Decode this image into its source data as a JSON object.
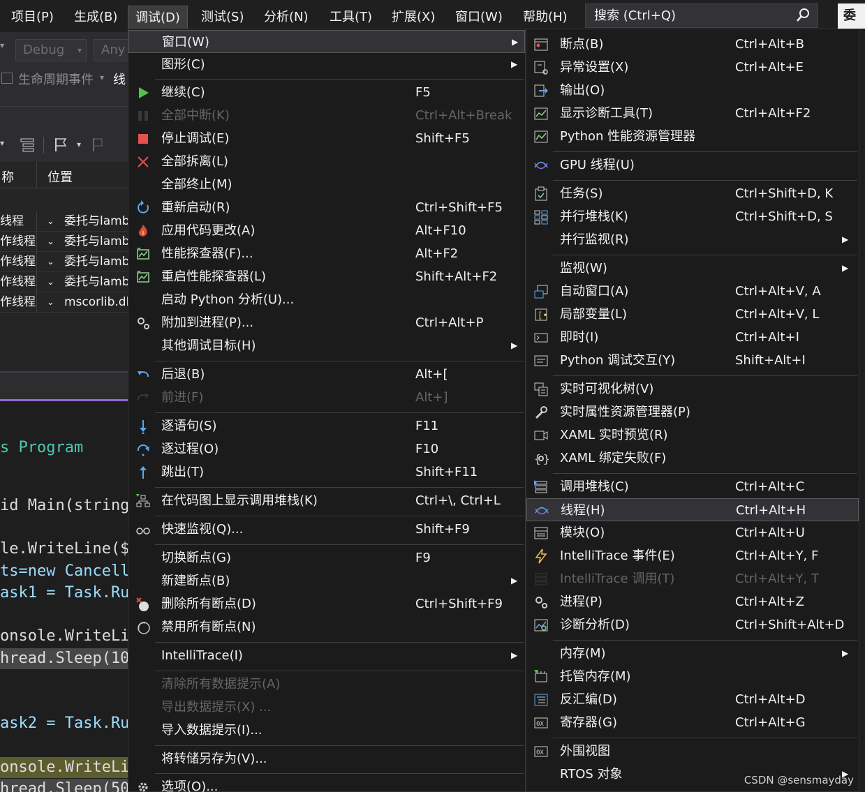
{
  "menubar": {
    "items": [
      "项目(P)",
      "生成(B)",
      "调试(D)",
      "测试(S)",
      "分析(N)",
      "工具(T)",
      "扩展(X)",
      "窗口(W)",
      "帮助(H)"
    ],
    "search_placeholder": "搜索 (Ctrl+Q)",
    "right_tab": "委托"
  },
  "toolbar": {
    "config": "Debug",
    "platform": "Any",
    "lifecycle": "生命周期事件",
    "thread_label": "线"
  },
  "threads_panel": {
    "col_name": "称",
    "col_location": "位置",
    "rows": [
      {
        "name": "线程",
        "location": "委托与lamb"
      },
      {
        "name": "作线程",
        "location": "委托与lamb"
      },
      {
        "name": "作线程",
        "location": "委托与lamb"
      },
      {
        "name": "作线程",
        "location": "委托与lamb"
      },
      {
        "name": "作线程",
        "location": "mscorlib.dll"
      }
    ]
  },
  "code": {
    "lines": [
      "s Program",
      "id Main(string",
      "le.WriteLine($",
      "ts=new Cancell",
      "ask1 = Task.Ru",
      "onsole.WriteLi",
      "hread.Sleep(10",
      "ask2 = Task.Ru",
      "onsole.WriteLi",
      "hread.Sleep(50"
    ]
  },
  "debug_menu": {
    "items": [
      {
        "label": "窗口(W)",
        "shortcut": "",
        "icon": "none",
        "submenu": true,
        "highlighted": true
      },
      {
        "label": "图形(C)",
        "shortcut": "",
        "icon": "none",
        "submenu": true
      },
      {
        "label": "继续(C)",
        "shortcut": "F5",
        "icon": "play-icon"
      },
      {
        "label": "全部中断(K)",
        "shortcut": "Ctrl+Alt+Break",
        "icon": "pause-icon",
        "disabled": true
      },
      {
        "label": "停止调试(E)",
        "shortcut": "Shift+F5",
        "icon": "stop-icon"
      },
      {
        "label": "全部拆离(L)",
        "shortcut": "",
        "icon": "detach-icon"
      },
      {
        "label": "全部终止(M)",
        "shortcut": "",
        "icon": "none"
      },
      {
        "label": "重新启动(R)",
        "shortcut": "Ctrl+Shift+F5",
        "icon": "restart-icon"
      },
      {
        "label": "应用代码更改(A)",
        "shortcut": "Alt+F10",
        "icon": "hot-reload-icon"
      },
      {
        "label": "性能探查器(F)...",
        "shortcut": "Alt+F2",
        "icon": "profiler-icon"
      },
      {
        "label": "重启性能探查器(L)",
        "shortcut": "Shift+Alt+F2",
        "icon": "profiler-icon"
      },
      {
        "label": "启动 Python 分析(U)...",
        "shortcut": "",
        "icon": "none"
      },
      {
        "label": "附加到进程(P)...",
        "shortcut": "Ctrl+Alt+P",
        "icon": "gears-icon"
      },
      {
        "label": "其他调试目标(H)",
        "shortcut": "",
        "icon": "none",
        "submenu": true
      },
      {
        "label": "后退(B)",
        "shortcut": "Alt+[",
        "icon": "back-icon"
      },
      {
        "label": "前进(F)",
        "shortcut": "Alt+]",
        "icon": "forward-icon",
        "disabled": true
      },
      {
        "label": "逐语句(S)",
        "shortcut": "F11",
        "icon": "step-into-icon"
      },
      {
        "label": "逐过程(O)",
        "shortcut": "F10",
        "icon": "step-over-icon"
      },
      {
        "label": "跳出(T)",
        "shortcut": "Shift+F11",
        "icon": "step-out-icon"
      },
      {
        "label": "在代码图上显示调用堆栈(K)",
        "shortcut": "Ctrl+\\, Ctrl+L",
        "icon": "code-map-icon"
      },
      {
        "label": "快速监视(Q)...",
        "shortcut": "Shift+F9",
        "icon": "glasses-icon"
      },
      {
        "label": "切换断点(G)",
        "shortcut": "F9",
        "icon": "none"
      },
      {
        "label": "新建断点(B)",
        "shortcut": "",
        "icon": "none",
        "submenu": true
      },
      {
        "label": "删除所有断点(D)",
        "shortcut": "Ctrl+Shift+F9",
        "icon": "delete-breakpoints-icon"
      },
      {
        "label": "禁用所有断点(N)",
        "shortcut": "",
        "icon": "disable-breakpoints-icon"
      },
      {
        "label": "IntelliTrace(I)",
        "shortcut": "",
        "icon": "none",
        "submenu": true
      },
      {
        "label": "清除所有数据提示(A)",
        "shortcut": "",
        "icon": "none",
        "disabled": true
      },
      {
        "label": "导出数据提示(X) ...",
        "shortcut": "",
        "icon": "none",
        "disabled": true
      },
      {
        "label": "导入数据提示(I)...",
        "shortcut": "",
        "icon": "none"
      },
      {
        "label": "将转储另存为(V)...",
        "shortcut": "",
        "icon": "none"
      },
      {
        "label": "选项(O)...",
        "shortcut": "",
        "icon": "gear-icon"
      }
    ]
  },
  "window_submenu": {
    "items": [
      {
        "label": "断点(B)",
        "shortcut": "Ctrl+Alt+B",
        "icon": "breakpoints-window-icon"
      },
      {
        "label": "异常设置(X)",
        "shortcut": "Ctrl+Alt+E",
        "icon": "exception-settings-icon"
      },
      {
        "label": "输出(O)",
        "shortcut": "",
        "icon": "output-icon"
      },
      {
        "label": "显示诊断工具(T)",
        "shortcut": "Ctrl+Alt+F2",
        "icon": "diagnostic-tools-icon"
      },
      {
        "label": "Python 性能资源管理器",
        "shortcut": "",
        "icon": "performance-explorer-icon"
      },
      {
        "label": "GPU 线程(U)",
        "shortcut": "",
        "icon": "gpu-threads-icon"
      },
      {
        "label": "任务(S)",
        "shortcut": "Ctrl+Shift+D, K",
        "icon": "tasks-icon"
      },
      {
        "label": "并行堆栈(K)",
        "shortcut": "Ctrl+Shift+D, S",
        "icon": "parallel-stacks-icon"
      },
      {
        "label": "并行监视(R)",
        "shortcut": "",
        "icon": "none",
        "submenu": true
      },
      {
        "label": "监视(W)",
        "shortcut": "",
        "icon": "none",
        "submenu": true
      },
      {
        "label": "自动窗口(A)",
        "shortcut": "Ctrl+Alt+V, A",
        "icon": "autos-icon"
      },
      {
        "label": "局部变量(L)",
        "shortcut": "Ctrl+Alt+V, L",
        "icon": "locals-icon"
      },
      {
        "label": "即时(I)",
        "shortcut": "Ctrl+Alt+I",
        "icon": "immediate-icon"
      },
      {
        "label": "Python 调试交互(Y)",
        "shortcut": "Shift+Alt+I",
        "icon": "python-interactive-icon"
      },
      {
        "label": "实时可视化树(V)",
        "shortcut": "",
        "icon": "visual-tree-icon"
      },
      {
        "label": "实时属性资源管理器(P)",
        "shortcut": "",
        "icon": "property-explorer-icon"
      },
      {
        "label": "XAML 实时预览(R)",
        "shortcut": "",
        "icon": "xaml-preview-icon"
      },
      {
        "label": "XAML 绑定失败(F)",
        "shortcut": "",
        "icon": "xaml-binding-icon"
      },
      {
        "label": "调用堆栈(C)",
        "shortcut": "Ctrl+Alt+C",
        "icon": "call-stack-icon"
      },
      {
        "label": "线程(H)",
        "shortcut": "Ctrl+Alt+H",
        "icon": "threads-icon",
        "highlighted": true
      },
      {
        "label": "模块(O)",
        "shortcut": "Ctrl+Alt+U",
        "icon": "modules-icon"
      },
      {
        "label": "IntelliTrace 事件(E)",
        "shortcut": "Ctrl+Alt+Y, F",
        "icon": "lightning-icon"
      },
      {
        "label": "IntelliTrace 调用(T)",
        "shortcut": "Ctrl+Alt+Y, T",
        "icon": "intellitrace-calls-icon",
        "disabled": true
      },
      {
        "label": "进程(P)",
        "shortcut": "Ctrl+Alt+Z",
        "icon": "processes-icon"
      },
      {
        "label": "诊断分析(D)",
        "shortcut": "Ctrl+Shift+Alt+D",
        "icon": "diagnostic-analysis-icon"
      },
      {
        "label": "内存(M)",
        "shortcut": "",
        "icon": "none",
        "submenu": true
      },
      {
        "label": "托管内存(M)",
        "shortcut": "",
        "icon": "managed-memory-icon"
      },
      {
        "label": "反汇编(D)",
        "shortcut": "Ctrl+Alt+D",
        "icon": "disassembly-icon"
      },
      {
        "label": "寄存器(G)",
        "shortcut": "Ctrl+Alt+G",
        "icon": "registers-icon"
      },
      {
        "label": "外围视图",
        "shortcut": "",
        "icon": "peripheral-view-icon"
      },
      {
        "label": "RTOS 对象",
        "shortcut": "",
        "icon": "none",
        "submenu": true
      }
    ]
  },
  "watermark": "CSDN @sensmayday",
  "colors": {
    "menu_bg": "#1b1b1c",
    "highlight": "#333337",
    "accent": "#8e6cd8",
    "text": "#f1f1f1",
    "disabled": "#656565"
  }
}
